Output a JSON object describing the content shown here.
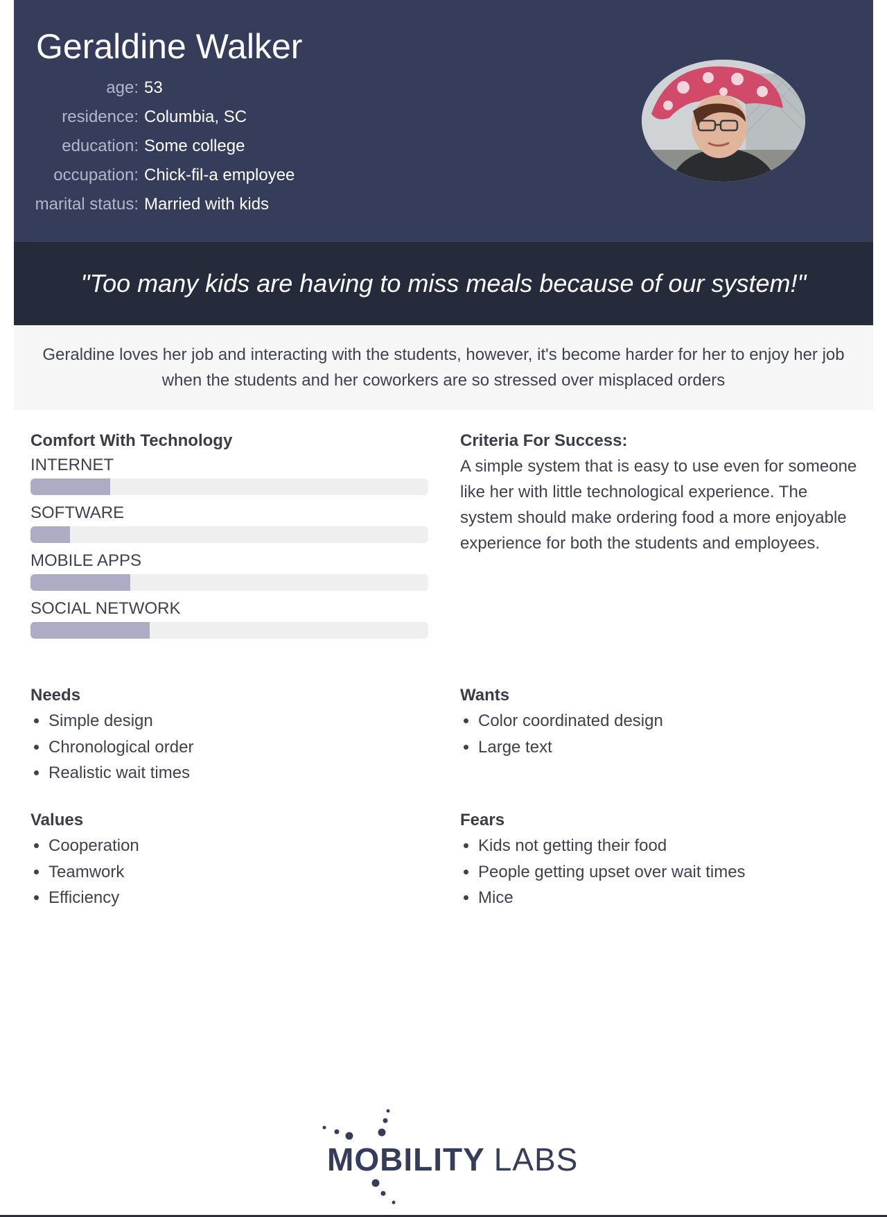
{
  "persona": {
    "name": "Geraldine Walker",
    "facts": [
      {
        "label": "age:",
        "value": "53"
      },
      {
        "label": "residence:",
        "value": "Columbia, SC"
      },
      {
        "label": "education:",
        "value": "Some college"
      },
      {
        "label": "occupation:",
        "value": "Chick-fil-a employee"
      },
      {
        "label": "marital status:",
        "value": "Married with kids"
      }
    ],
    "avatar_icon": "persona-photo"
  },
  "quote": "\"Too many kids are having to miss meals because of our system!\"",
  "bio": "Geraldine loves her job and interacting with the students, however, it's become harder for her to enjoy her job when the students and her coworkers are so stressed over misplaced orders",
  "comfort": {
    "title": "Comfort With Technology",
    "skills": [
      {
        "label": "INTERNET",
        "level": 0.2
      },
      {
        "label": "SOFTWARE",
        "level": 0.1
      },
      {
        "label": "MOBILE APPS",
        "level": 0.25
      },
      {
        "label": "SOCIAL NETWORK",
        "level": 0.3
      }
    ]
  },
  "criteria": {
    "title": "Criteria For Success:",
    "text": "A simple system that is easy to use even for someone like her with little technological experience. The system should make ordering food a more enjoyable experience for both the students and employees."
  },
  "needs": {
    "title": "Needs",
    "items": [
      "Simple design",
      "Chronological order",
      "Realistic wait times"
    ]
  },
  "wants": {
    "title": "Wants",
    "items": [
      "Color coordinated design",
      "Large text"
    ]
  },
  "values": {
    "title": "Values",
    "items": [
      "Cooperation",
      "Teamwork",
      "Efficiency"
    ]
  },
  "fears": {
    "title": "Fears",
    "items": [
      "Kids not getting their food",
      "People getting upset over wait times",
      "Mice"
    ]
  },
  "logo": {
    "text_bold": "MOBILITY",
    "text_light": "LABS"
  },
  "colors": {
    "header_bg": "#363d5a",
    "quote_bg": "#252b3b",
    "bar_fill": "#acadc5",
    "bar_track": "#efefef"
  }
}
